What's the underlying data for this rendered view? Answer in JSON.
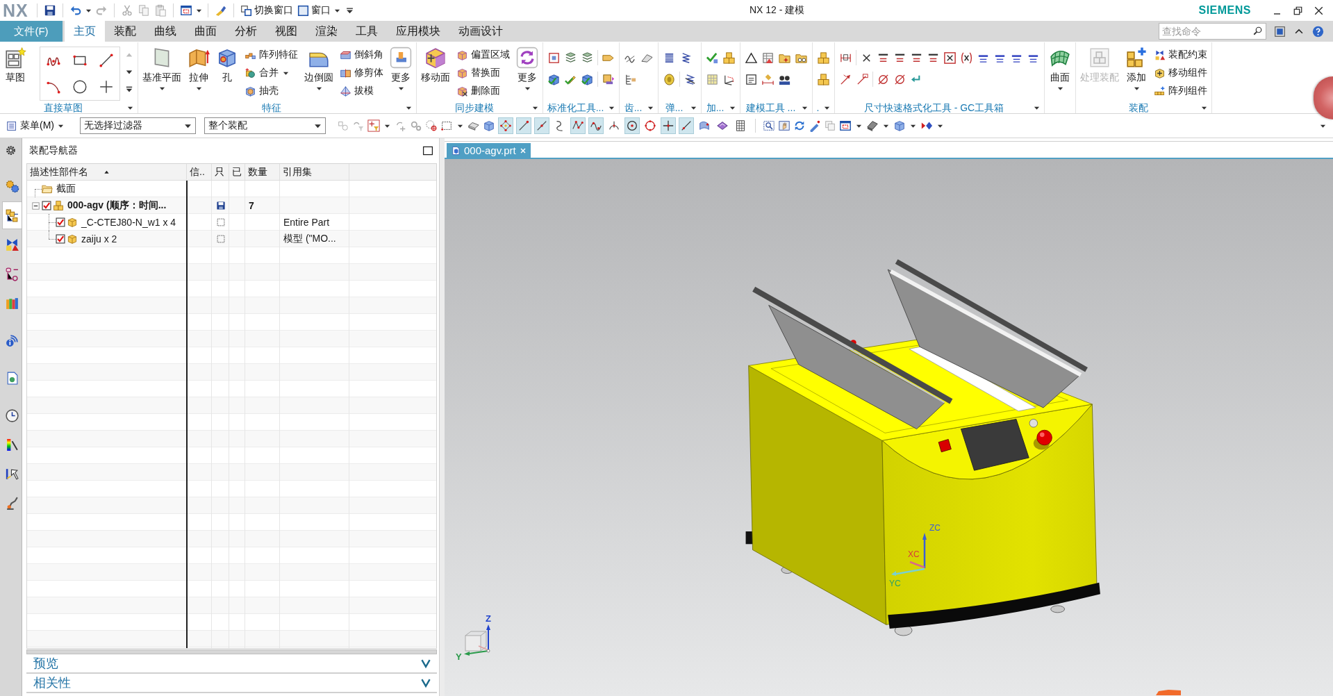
{
  "title_bar": {
    "logo": "NX",
    "commands": [
      {
        "label": "切换窗口",
        "menu": false
      },
      {
        "label": "窗口",
        "menu": true
      }
    ],
    "title": "NX 12 - 建模",
    "brand": "SIEMENS"
  },
  "menu_bar": {
    "file_tab": "文件(F)",
    "tabs": [
      {
        "label": "主页",
        "selected": true
      },
      {
        "label": "装配",
        "selected": false
      },
      {
        "label": "曲线",
        "selected": false
      },
      {
        "label": "曲面",
        "selected": false
      },
      {
        "label": "分析",
        "selected": false
      },
      {
        "label": "视图",
        "selected": false
      },
      {
        "label": "渲染",
        "selected": false
      },
      {
        "label": "工具",
        "selected": false
      },
      {
        "label": "应用模块",
        "selected": false
      },
      {
        "label": "动画设计",
        "selected": false
      }
    ],
    "search": {
      "placeholder": "查找命令"
    }
  },
  "ribbon": {
    "groups": [
      {
        "label": "直接草图",
        "menu": true,
        "items": [
          {
            "kind": "large",
            "label": "草图",
            "menu": false,
            "disabled": false
          },
          {
            "kind": "gallery"
          }
        ]
      },
      {
        "label": "特征",
        "menu": true,
        "items": [
          {
            "kind": "large",
            "label": "基准平面",
            "menu": true,
            "disabled": false
          },
          {
            "kind": "large",
            "label": "拉伸",
            "menu": true,
            "disabled": false
          },
          {
            "kind": "large",
            "label": "孔",
            "menu": false,
            "disabled": false
          },
          {
            "kind": "stack",
            "buttons": [
              {
                "label": "阵列特征",
                "menu": false
              },
              {
                "label": "合并",
                "menu": true
              },
              {
                "label": "抽壳",
                "menu": false
              }
            ]
          },
          {
            "kind": "large",
            "label": "边倒圆",
            "menu": true,
            "disabled": false
          },
          {
            "kind": "stack",
            "buttons": [
              {
                "label": "倒斜角",
                "menu": false
              },
              {
                "label": "修剪体",
                "menu": false
              },
              {
                "label": "拔模",
                "menu": false
              }
            ]
          },
          {
            "kind": "large",
            "label": "更多",
            "menu": true,
            "disabled": false
          }
        ]
      },
      {
        "label": "同步建模",
        "menu": true,
        "items": [
          {
            "kind": "large",
            "label": "移动面",
            "menu": false,
            "disabled": false
          },
          {
            "kind": "stack",
            "buttons": [
              {
                "label": "偏置区域",
                "menu": false
              },
              {
                "label": "替换面",
                "menu": false
              },
              {
                "label": "删除面",
                "menu": false
              }
            ]
          },
          {
            "kind": "large",
            "label": "更多",
            "menu": true,
            "disabled": false
          }
        ]
      },
      {
        "label": "标准化工具...",
        "menu": true,
        "items": [
          {
            "kind": "icons"
          }
        ]
      },
      {
        "label": "齿...",
        "menu": true,
        "items": [
          {
            "kind": "icons"
          }
        ]
      },
      {
        "label": "弹...",
        "menu": true,
        "items": [
          {
            "kind": "icons"
          }
        ]
      },
      {
        "label": "加...",
        "menu": true,
        "items": [
          {
            "kind": "icons"
          }
        ]
      },
      {
        "label": "建模工具 ...",
        "menu": true,
        "items": [
          {
            "kind": "icons"
          }
        ]
      },
      {
        "label": ".",
        "menu": true,
        "items": [
          {
            "kind": "icons"
          }
        ]
      },
      {
        "label": "尺寸快速格式化工具 - GC工具箱",
        "menu": true,
        "items": [
          {
            "kind": "icons"
          }
        ]
      },
      {
        "menu": false,
        "items": [
          {
            "kind": "large",
            "label": "曲面",
            "menu": true,
            "disabled": false
          }
        ]
      },
      {
        "label": "装配",
        "menu": true,
        "items": [
          {
            "kind": "large",
            "label": "处理装配",
            "menu": false,
            "disabled": true
          },
          {
            "kind": "large",
            "label": "添加",
            "menu": true,
            "disabled": false
          },
          {
            "kind": "stack",
            "buttons": [
              {
                "label": "装配约束",
                "menu": false
              },
              {
                "label": "移动组件",
                "menu": false
              },
              {
                "label": "阵列组件",
                "menu": false
              }
            ]
          }
        ]
      }
    ]
  },
  "selection_bar": {
    "menu": "菜单(M)",
    "filter": "无选择过滤器",
    "scope": "整个装配",
    "snap_points": [
      {
        "on": true
      },
      {
        "on": true
      },
      {
        "on": true
      },
      {
        "on": false
      },
      {
        "on": true
      },
      {
        "on": true
      },
      {
        "on": false
      },
      {
        "on": true
      },
      {
        "on": false
      },
      {
        "on": true
      },
      {
        "on": true
      },
      {
        "on": false
      },
      {
        "on": false
      },
      {
        "on": false
      }
    ]
  },
  "resource_bar": {
    "tabs": [
      {
        "selected": false
      },
      {
        "selected": true
      },
      {
        "selected": false
      },
      {
        "selected": false
      },
      {
        "selected": false
      },
      {
        "selected": false
      },
      {
        "selected": false
      },
      {
        "selected": false
      },
      {
        "selected": false
      },
      {
        "selected": false
      },
      {
        "selected": false
      }
    ]
  },
  "assembly_navigator": {
    "title": "装配导航器",
    "columns": [
      {
        "label": "描述性部件名",
        "sorted": true
      },
      {
        "label": "信..",
        "sorted": false
      },
      {
        "label": "只",
        "sorted": false
      },
      {
        "label": "已",
        "sorted": false
      },
      {
        "label": "数量",
        "sorted": false
      },
      {
        "label": "引用集",
        "sorted": false
      }
    ],
    "rows": [
      {
        "kind": "folder",
        "name": "截面"
      },
      {
        "kind": "assembly",
        "name": "000-agv (顺序：时间...",
        "checked": true,
        "expanded": true,
        "modified": true,
        "quantity": "7",
        "children": [
          {
            "kind": "component",
            "name": "_C-CTEJ80-N_w1 x 4",
            "checked": true,
            "modified": false,
            "reference_set": "Entire Part"
          },
          {
            "kind": "component",
            "name": "zaiju x 2",
            "checked": true,
            "modified": false,
            "reference_set": "模型 (\"MO..."
          }
        ]
      }
    ],
    "panels": [
      {
        "label": "预览",
        "expanded": false
      },
      {
        "label": "相关性",
        "expanded": false
      }
    ]
  },
  "graphics_window": {
    "tabs": [
      {
        "label": "000-agv.prt",
        "selected": true
      }
    ],
    "wcs_labels": [
      {
        "text": "ZC",
        "color": "#3b5fd6"
      },
      {
        "text": "XC",
        "color": "#d83a3a"
      },
      {
        "text": "YC",
        "color": "#27a06a"
      }
    ],
    "triad_labels": [
      {
        "text": "Z",
        "color": "#2244cc"
      },
      {
        "text": "Y",
        "color": "#2a9a4a"
      }
    ]
  }
}
